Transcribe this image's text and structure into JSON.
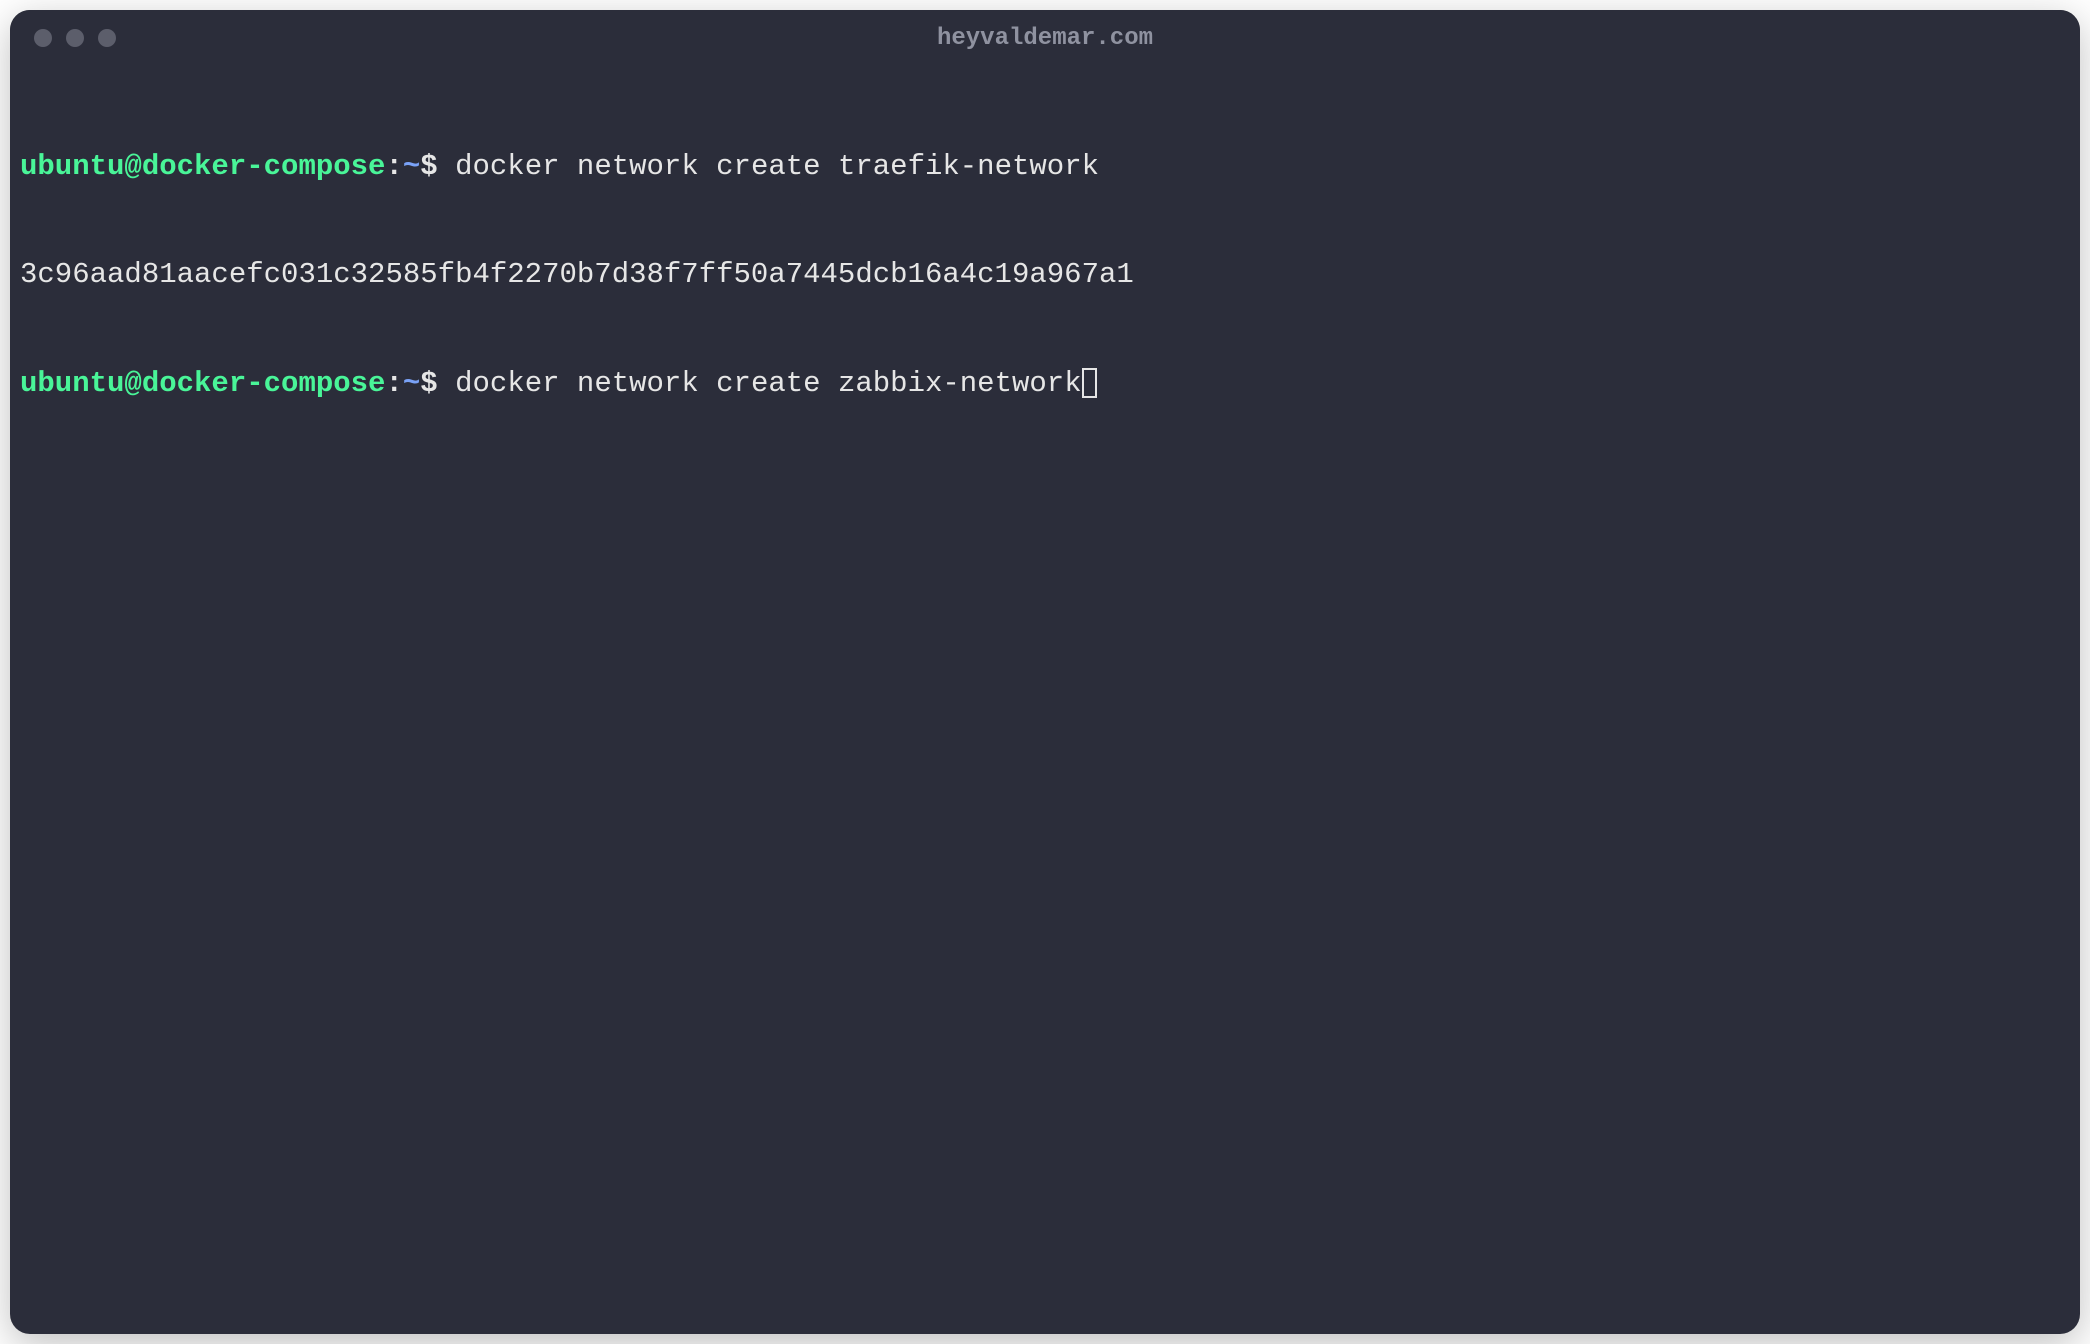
{
  "window": {
    "title": "heyvaldemar.com"
  },
  "prompt": {
    "user_host": "ubuntu@docker-compose",
    "colon": ":",
    "path": "~",
    "dollar": "$"
  },
  "lines": {
    "cmd1": " docker network create traefik-network",
    "out1": "3c96aad81aacefc031c32585fb4f2270b7d38f7ff50a7445dcb16a4c19a967a1",
    "cmd2": " docker network create zabbix-network"
  }
}
